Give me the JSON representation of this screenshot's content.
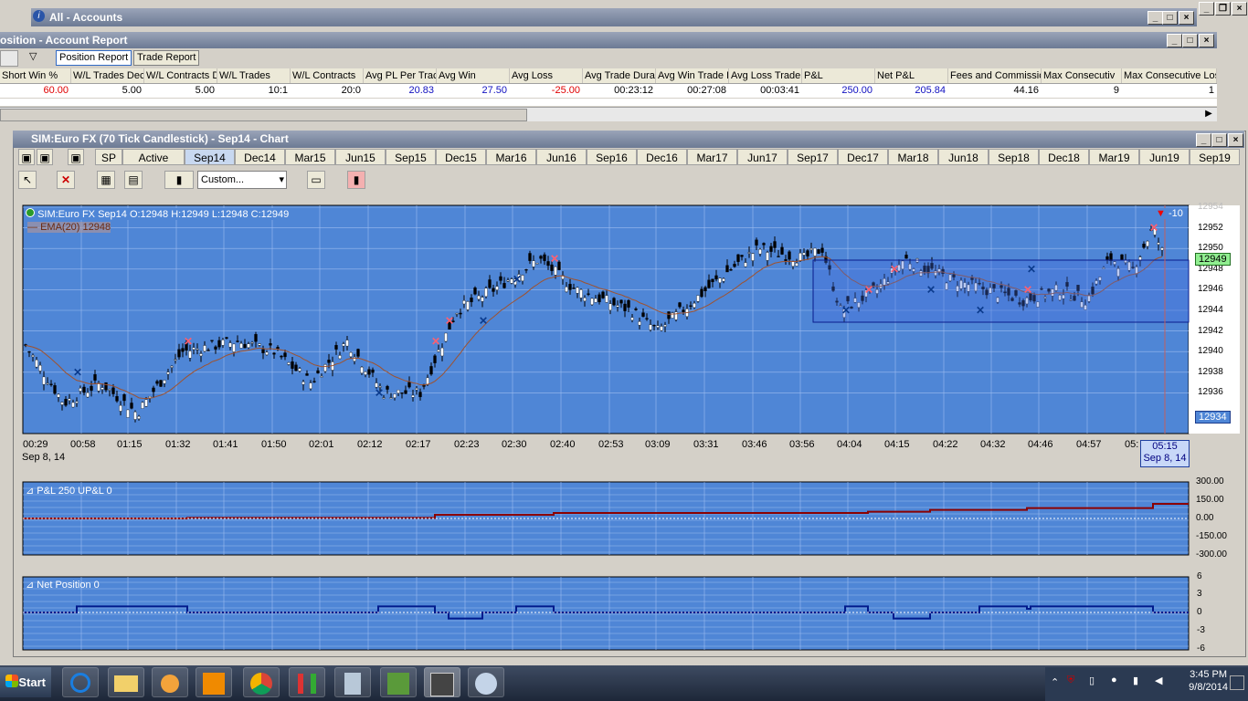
{
  "accounts_window": {
    "title": "All - Accounts"
  },
  "report_window": {
    "title": "osition - Account Report",
    "tabs": [
      "Position Report",
      "Trade Report"
    ],
    "columns": [
      "Short Win %",
      "W/L Trades Dec",
      "W/L Contracts D",
      "W/L Trades",
      "W/L Contracts",
      "Avg PL Per Trac",
      "Avg Win",
      "Avg Loss",
      "Avg Trade Dura",
      "Avg Win Trade I",
      "Avg Loss Trade",
      "P&L",
      "Net P&L",
      "Fees and Commissio",
      "Max Consecutiv",
      "Max Consecutive Loss"
    ],
    "values": [
      "60.00",
      "5.00",
      "5.00",
      "10:1",
      "20:0",
      "20.83",
      "27.50",
      "-25.00",
      "00:23:12",
      "00:27:08",
      "00:03:41",
      "250.00",
      "205.84",
      "44.16",
      "9",
      "1"
    ]
  },
  "chart_window": {
    "title": "SIM:Euro FX (70 Tick Candlestick) - Sep14 - Chart",
    "tabs": [
      "SP",
      "Active",
      "Sep14",
      "Dec14",
      "Mar15",
      "Jun15",
      "Sep15",
      "Dec15",
      "Mar16",
      "Jun16",
      "Sep16",
      "Dec16",
      "Mar17",
      "Jun17",
      "Sep17",
      "Dec17",
      "Mar18",
      "Jun18",
      "Sep18",
      "Dec18",
      "Mar19",
      "Jun19",
      "Sep19"
    ],
    "selected_tab": "Sep14",
    "template_combo": "Custom..."
  },
  "price_panel": {
    "legend": "SIM:Euro FX Sep14 O:12948 H:12949 L:12948 C:12949",
    "ema_label": "EMA(20)  12948",
    "position_marker": "-10",
    "current_price": "12949",
    "low_marker": "12934",
    "x_ticks": [
      "00:29",
      "00:58",
      "01:15",
      "01:32",
      "01:41",
      "01:50",
      "02:01",
      "02:12",
      "02:17",
      "02:23",
      "02:30",
      "02:40",
      "02:53",
      "03:09",
      "03:31",
      "03:46",
      "03:56",
      "04:04",
      "04:15",
      "04:22",
      "04:32",
      "04:46",
      "04:57",
      "05:"
    ],
    "date_label": "Sep 8, 14",
    "cursor_time": "05:15",
    "cursor_date": "Sep 8, 14",
    "y_ticks": [
      "12954",
      "12952",
      "12950",
      "12948",
      "12946",
      "12944",
      "12942",
      "12940",
      "12938",
      "12936"
    ]
  },
  "pnl_panel": {
    "label": "P&L  250   UP&L  0",
    "y_ticks": [
      "300.00",
      "150.00",
      "0.00",
      "-150.00",
      "-300.00"
    ]
  },
  "pos_panel": {
    "label": "Net Position  0",
    "y_ticks": [
      "6",
      "3",
      "0",
      "-3",
      "-6"
    ]
  },
  "taskbar": {
    "start": "Start",
    "time": "3:45 PM",
    "date": "9/8/2014"
  },
  "colors": {
    "plot_bg": "#4f86d6",
    "ema": "#a0522d",
    "pnl_line": "#8b0000",
    "pos_line": "#001a8c"
  }
}
